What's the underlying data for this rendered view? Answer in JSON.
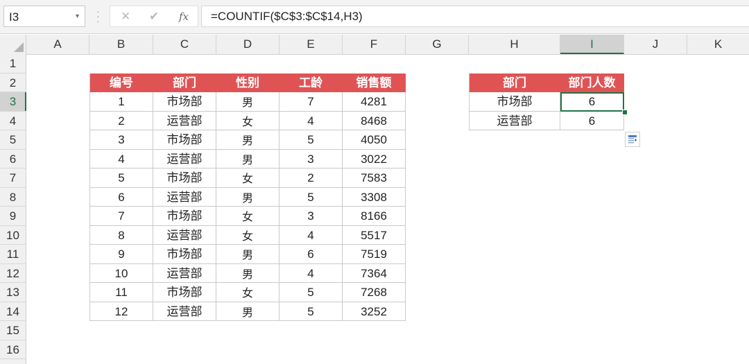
{
  "formula_bar": {
    "name_box": "I3",
    "cancel_icon": "✕",
    "enter_icon": "✔",
    "fx_label": "fx",
    "formula": "=COUNTIF($C$3:$C$14,H3)"
  },
  "columns": [
    "A",
    "B",
    "C",
    "D",
    "E",
    "F",
    "G",
    "H",
    "I",
    "J",
    "K"
  ],
  "selected_column": "I",
  "rows": [
    "1",
    "2",
    "3",
    "4",
    "5",
    "6",
    "7",
    "8",
    "9",
    "10",
    "11",
    "12",
    "13",
    "14",
    "15",
    "16"
  ],
  "selected_row": "3",
  "main_table": {
    "headers": [
      "编号",
      "部门",
      "性别",
      "工龄",
      "销售额"
    ],
    "rows": [
      [
        "1",
        "市场部",
        "男",
        "7",
        "4281"
      ],
      [
        "2",
        "运营部",
        "女",
        "4",
        "8468"
      ],
      [
        "3",
        "市场部",
        "男",
        "5",
        "4050"
      ],
      [
        "4",
        "运营部",
        "男",
        "3",
        "3022"
      ],
      [
        "5",
        "市场部",
        "女",
        "2",
        "7583"
      ],
      [
        "6",
        "运营部",
        "男",
        "5",
        "3308"
      ],
      [
        "7",
        "市场部",
        "女",
        "3",
        "8166"
      ],
      [
        "8",
        "运营部",
        "女",
        "4",
        "5517"
      ],
      [
        "9",
        "市场部",
        "男",
        "6",
        "7519"
      ],
      [
        "10",
        "运营部",
        "男",
        "4",
        "7364"
      ],
      [
        "11",
        "市场部",
        "女",
        "5",
        "7268"
      ],
      [
        "12",
        "运营部",
        "男",
        "5",
        "3252"
      ]
    ]
  },
  "summary_table": {
    "headers": [
      "部门",
      "部门人数"
    ],
    "rows": [
      [
        "市场部",
        "6"
      ],
      [
        "运营部",
        "6"
      ]
    ]
  },
  "colors": {
    "header_fill": "#e05355",
    "selection": "#217346"
  },
  "icons": {
    "name_box_dropdown": "chevron-down-icon",
    "quick_analysis": "quick-analysis-icon"
  }
}
